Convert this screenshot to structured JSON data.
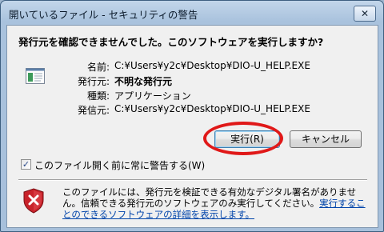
{
  "window": {
    "title": "開いているファイル - セキュリティの警告",
    "close_glyph": "✕"
  },
  "question": "発行元を確認できませんでした。このソフトウェアを実行しますか?",
  "file_info": {
    "name_label": "名前:",
    "name_value": "C:¥Users¥y2c¥Desktop¥DIO-U_HELP.EXE",
    "publisher_label": "発行元:",
    "publisher_value": "不明な発行元",
    "type_label": "種類:",
    "type_value": "アプリケーション",
    "from_label": "発信元:",
    "from_value": "C:¥Users¥y2c¥Desktop¥DIO-U_HELP.EXE"
  },
  "buttons": {
    "run": "実行(R)",
    "cancel": "キャンセル"
  },
  "checkbox": {
    "label": "このファイル開く前に常に警告する(W)",
    "checked_glyph": "✓"
  },
  "warning": {
    "text": "このファイルには、発行元を検証できる有効なデジタル署名がありません。信頼できる発行元のソフトウェアのみ実行してください。",
    "link": "実行することのできるソフトウェアの詳細を表示します。"
  },
  "colors": {
    "highlight_ellipse": "#e01818",
    "link": "#0044aa"
  }
}
